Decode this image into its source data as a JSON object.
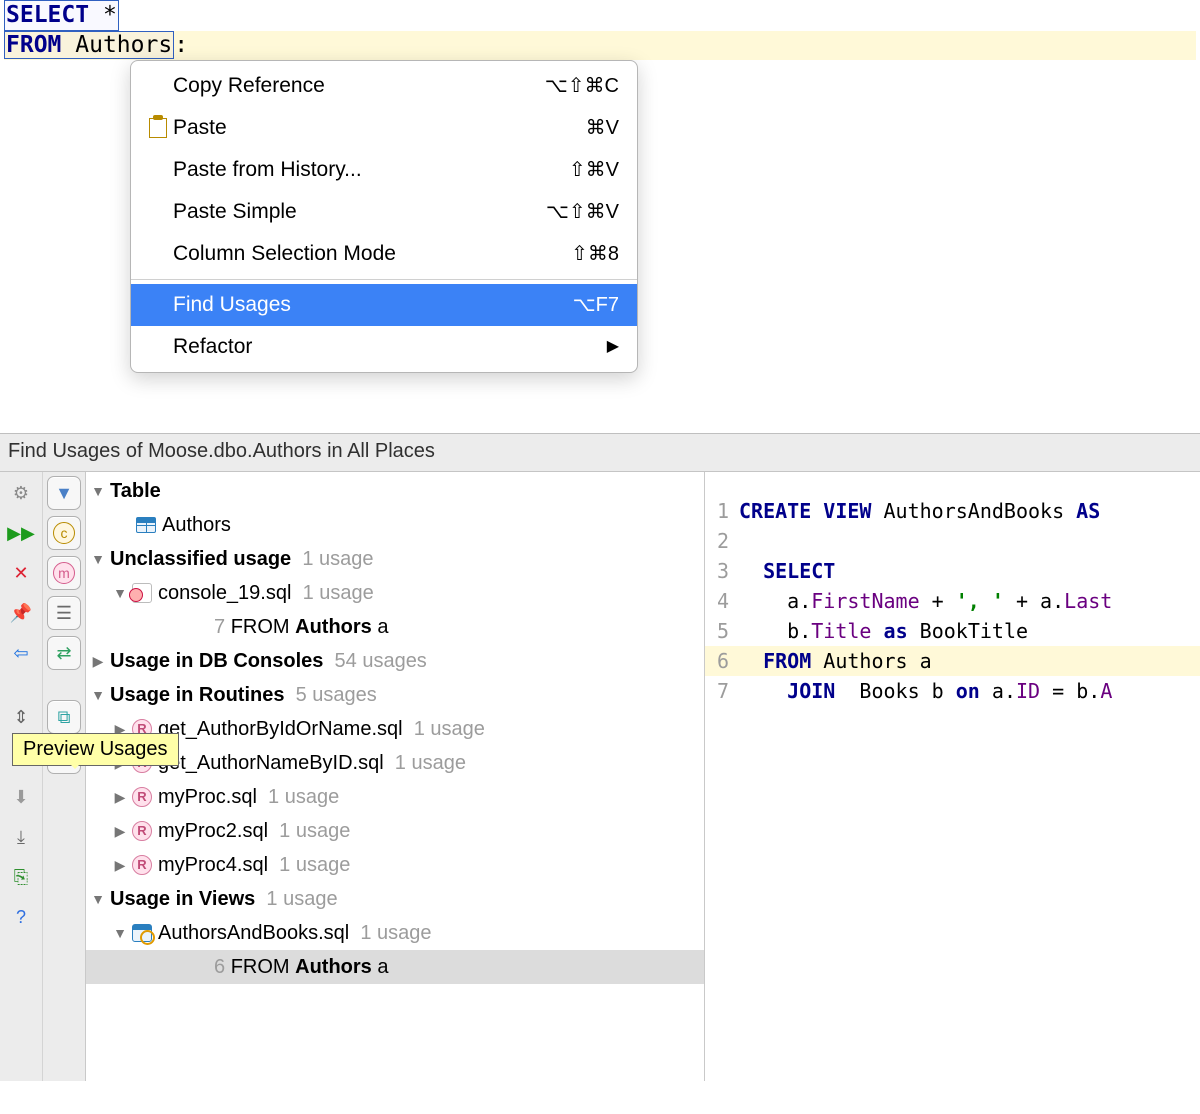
{
  "editor": {
    "line1_kw": "SELECT",
    "line1_rest": " *",
    "line2_kw": "FROM",
    "line2_tbl": "Authors",
    "line2_suffix": ":"
  },
  "context_menu": [
    {
      "name": "copy-reference",
      "label": "Copy Reference",
      "shortcut": "⌥⇧⌘C",
      "icon": ""
    },
    {
      "name": "paste",
      "label": "Paste",
      "shortcut": "⌘V",
      "icon": "paste"
    },
    {
      "name": "paste-history",
      "label": "Paste from History...",
      "shortcut": "⇧⌘V",
      "icon": ""
    },
    {
      "name": "paste-simple",
      "label": "Paste Simple",
      "shortcut": "⌥⇧⌘V",
      "icon": ""
    },
    {
      "name": "column-sel",
      "label": "Column Selection Mode",
      "shortcut": "⇧⌘8",
      "icon": ""
    },
    {
      "sep": true
    },
    {
      "name": "find-usages",
      "label": "Find Usages",
      "shortcut": "⌥F7",
      "icon": "",
      "highlight": true
    },
    {
      "name": "refactor",
      "label": "Refactor",
      "shortcut": "",
      "icon": "",
      "submenu": true
    }
  ],
  "panel": {
    "title": "Find Usages of Moose.dbo.Authors in All Places",
    "tooltip": "Preview Usages",
    "tree": {
      "table_heading": "Table",
      "table_name": "Authors",
      "unclassified_heading": "Unclassified usage",
      "unclassified_count": "1 usage",
      "unclassified_file": "console_19.sql",
      "unclassified_file_count": "1 usage",
      "unclassified_line_num": "7",
      "unclassified_line_kw": "FROM",
      "unclassified_line_tbl": "Authors",
      "unclassified_line_alias": "a",
      "dbconsoles_heading": "Usage in DB Consoles",
      "dbconsoles_count": "54 usages",
      "routines_heading": "Usage in Routines",
      "routines_count": "5 usages",
      "routines": [
        {
          "file": "get_AuthorByIdOrName.sql",
          "count": "1 usage"
        },
        {
          "file": "get_AuthorNameByID.sql",
          "count": "1 usage"
        },
        {
          "file": "myProc.sql",
          "count": "1 usage"
        },
        {
          "file": "myProc2.sql",
          "count": "1 usage"
        },
        {
          "file": "myProc4.sql",
          "count": "1 usage"
        }
      ],
      "views_heading": "Usage in Views",
      "views_count": "1 usage",
      "views_file": "AuthorsAndBooks.sql",
      "views_file_count": "1 usage",
      "views_line_num": "6",
      "views_line_kw": "FROM",
      "views_line_tbl": "Authors",
      "views_line_alias": "a"
    },
    "preview": [
      {
        "n": "1",
        "pre_kw": "CREATE VIEW",
        "mid": " AuthorsAndBooks ",
        "post_kw": "AS"
      },
      {
        "n": "2",
        "plain": ""
      },
      {
        "n": "3",
        "indent": "  ",
        "kw": "SELECT"
      },
      {
        "n": "4",
        "indent": "    ",
        "alias": "a",
        "dot": ".",
        "field": "FirstName",
        "rest1": " + ",
        "str": "', '",
        "rest2": " + a",
        "dot2": ".",
        "field2": "Last"
      },
      {
        "n": "5",
        "indent": "    ",
        "alias": "b",
        "dot": ".",
        "field": "Title",
        "kw_as": " as ",
        "rest": "BookTitle"
      },
      {
        "n": "6",
        "hl": true,
        "indent": "  ",
        "kw": "FROM",
        "rest": " Authors a"
      },
      {
        "n": "7",
        "indent": "    ",
        "kw": "JOIN",
        "mid": "  Books b ",
        "kw2": "on",
        "rest": " a",
        "dot": ".",
        "field": "ID",
        "eq": " = b",
        "dot2": ".",
        "field2": "A"
      }
    ]
  }
}
